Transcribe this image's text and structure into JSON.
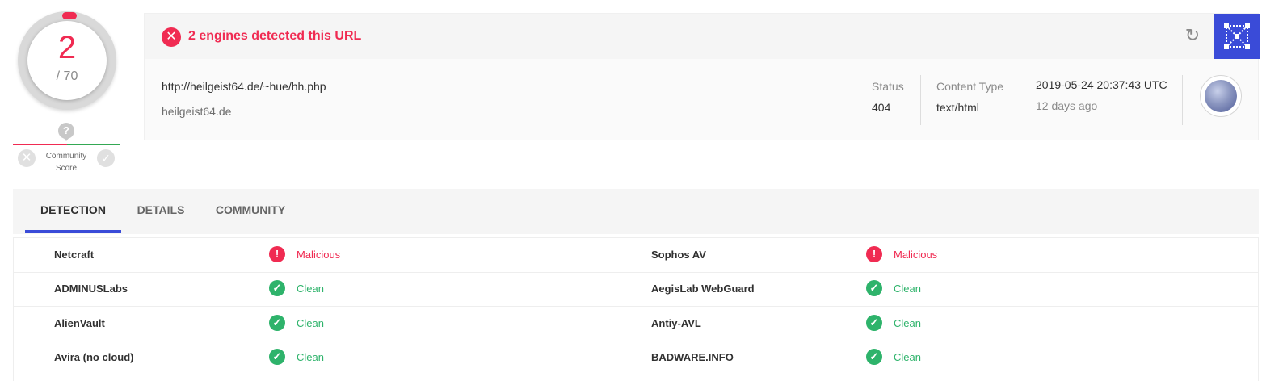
{
  "score": {
    "detections": "2",
    "total": "/ 70"
  },
  "community": {
    "label_line1": "Community",
    "label_line2": "Score",
    "question": "?"
  },
  "alert": {
    "text": "2 engines detected this URL"
  },
  "url_info": {
    "url": "http://heilgeist64.de/~hue/hh.php",
    "domain": "heilgeist64.de",
    "status_label": "Status",
    "status_value": "404",
    "content_type_label": "Content Type",
    "content_type_value": "text/html",
    "date": "2019-05-24 20:37:43 UTC",
    "ago": "12 days ago"
  },
  "icons": {
    "alert": "close-circle-icon",
    "reload": "reload-icon",
    "graph": "graph-icon",
    "favicon": "globe-icon",
    "malicious": "exclamation-circle-icon",
    "clean": "check-circle-icon"
  },
  "colors": {
    "malicious": "#f02b52",
    "clean": "#2eb36b",
    "accent": "#3a4bd8"
  },
  "tabs": [
    {
      "label": "DETECTION",
      "active": true
    },
    {
      "label": "DETAILS",
      "active": false
    },
    {
      "label": "COMMUNITY",
      "active": false
    }
  ],
  "detections": [
    {
      "left_engine": "Netcraft",
      "left_result": "Malicious",
      "right_engine": "Sophos AV",
      "right_result": "Malicious"
    },
    {
      "left_engine": "ADMINUSLabs",
      "left_result": "Clean",
      "right_engine": "AegisLab WebGuard",
      "right_result": "Clean"
    },
    {
      "left_engine": "AlienVault",
      "left_result": "Clean",
      "right_engine": "Antiy-AVL",
      "right_result": "Clean"
    },
    {
      "left_engine": "Avira (no cloud)",
      "left_result": "Clean",
      "right_engine": "BADWARE.INFO",
      "right_result": "Clean"
    }
  ]
}
